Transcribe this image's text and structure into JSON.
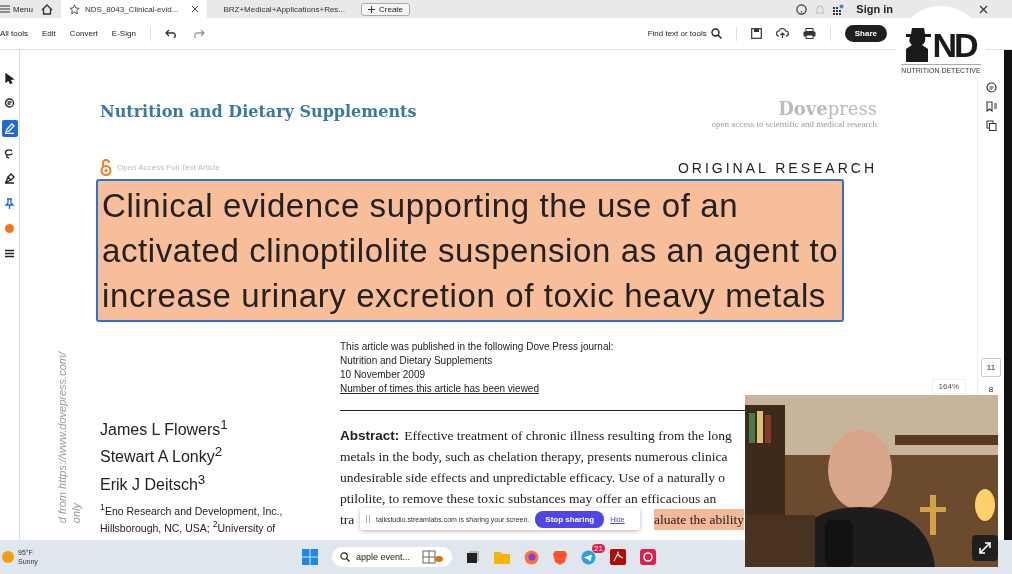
{
  "title_bar": {
    "menu": "Menu",
    "tabs": [
      {
        "label": "NDS_8043_Clinical-evid...",
        "selected": true,
        "closable": true
      },
      {
        "label": "BRZ+Medical+Applications+Res...",
        "selected": false,
        "closable": false
      }
    ],
    "create": "Create",
    "sign_in": "Sign in"
  },
  "toolbar": {
    "items": [
      "All tools",
      "Edit",
      "Convert",
      "E-Sign"
    ],
    "search": "Find text or tools",
    "share": "Share"
  },
  "left_tools": [
    {
      "kind": "pointer",
      "selected": false
    },
    {
      "kind": "comment",
      "selected": false
    },
    {
      "kind": "pen",
      "selected": true
    },
    {
      "kind": "lasso",
      "selected": false
    },
    {
      "kind": "sign",
      "selected": false
    },
    {
      "kind": "pin",
      "selected": false
    },
    {
      "kind": "color",
      "selected": false
    },
    {
      "kind": "menu",
      "selected": false
    }
  ],
  "document": {
    "journal": "Nutrition and Dietary Supplements",
    "publisher": "**Dove**press",
    "tagline": "open access to scientific and medical research",
    "open_access": "Open Access Full Text Article",
    "section": "ORIGINAL RESEARCH",
    "title_lines": [
      "Clinical evidence supporting the use of an",
      "activated clinoptilolite suspension as an agent to",
      "increase urinary excretion of toxic heavy metals"
    ],
    "publication_info": [
      "This article was published in the following Dove Press journal:",
      "Nutrition and Dietary Supplements",
      "10 November 2009"
    ],
    "views_link": "Number of times this article has been viewed",
    "authors": [
      "James L Flowers$^{1}$",
      "Stewart A Lonky$^{2}$",
      "Erik J Deitsch$^{3}$"
    ],
    "affiliations": [
      "$^{1}$Eno Research and Development, Inc.,",
      "Hillsborough, NC, USA; $^{2}$University of"
    ],
    "abstract_label": "Abstract:",
    "abstract_lines": [
      "Effective treatment of chronic illness resulting from the long",
      "metals in the body, such as chelation therapy, presents numerous clinica",
      "undesirable side effects and unpredictable efficacy. Use of a naturally o",
      "ptilolite, to remove these toxic substances may offer an efficacious an"
    ],
    "abstract_last": {
      "start": "tra",
      "highlighted": "aluate the ability"
    },
    "side_note": [
      "d from https://www.dovepress.com/",
      "only"
    ]
  },
  "right_rail": {
    "page": "11",
    "total": "8",
    "zoom": "164%"
  },
  "logo": {
    "mark": "ND",
    "caption": "NUTRITION DETECTIVE"
  },
  "sharing_bar": {
    "message": "talkstudio.streamlabs.com is sharing your screen.",
    "stop": "Stop sharing",
    "hide": "Hide"
  },
  "taskbar": {
    "temperature": "95°F",
    "condition": "Sunny",
    "search": "apple event...",
    "badge": "21"
  }
}
